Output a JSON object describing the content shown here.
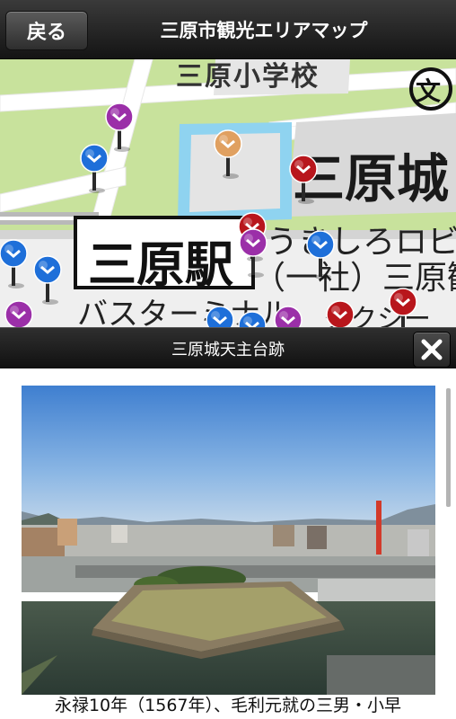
{
  "header": {
    "back_label": "戻る",
    "title": "三原市観光エリアマップ"
  },
  "map": {
    "labels": {
      "school": "三原小学校",
      "castle": "三原城",
      "station": "三原駅",
      "ukishiro": "うきしろロビ",
      "corp": "（一社）三原観",
      "bus": "バスターミナル",
      "taxi": "タクシー"
    },
    "school_symbol": "文",
    "pin_colors": {
      "blue": "#1e6fd9",
      "purple": "#9b2fa8",
      "red": "#b8161c",
      "orange": "#e0a060"
    }
  },
  "popup": {
    "title": "三原城天主台跡",
    "close_icon": "close-icon"
  },
  "content": {
    "description": "永禄10年（1567年）、毛利元就の三男・小早"
  }
}
